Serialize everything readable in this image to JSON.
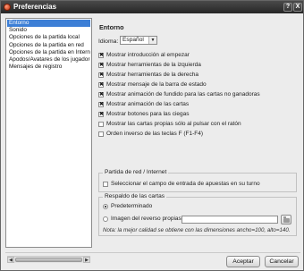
{
  "window": {
    "title": "Preferencias",
    "help_label": "?",
    "close_label": "X"
  },
  "sidebar": {
    "items": [
      {
        "label": "Entorno",
        "selected": true
      },
      {
        "label": "Sonido",
        "selected": false
      },
      {
        "label": "Opciones de la partida local",
        "selected": false
      },
      {
        "label": "Opciones de la partida en red",
        "selected": false
      },
      {
        "label": "Opciones de la partida en Internet",
        "selected": false
      },
      {
        "label": "Apodos/Avatares de los jugadores",
        "selected": false
      },
      {
        "label": "Mensajes de registro",
        "selected": false
      }
    ],
    "scroll_left": "◀",
    "scroll_right": "▶"
  },
  "panel": {
    "title": "Entorno",
    "language_label": "Idioma:",
    "language_value": "Español",
    "language_caret": "▼",
    "options": [
      {
        "label": "Mostrar introducción al empezar",
        "checked": true,
        "mark": "✖"
      },
      {
        "label": "Mostrar herramientas de la izquierda",
        "checked": true,
        "mark": "✖"
      },
      {
        "label": "Mostrar herramientas de la derecha",
        "checked": true,
        "mark": "✖"
      },
      {
        "label": "Mostrar mensaje de la barra de estado",
        "checked": true,
        "mark": "✖"
      },
      {
        "label": "Mostrar animación de fundido para las cartas no ganadoras",
        "checked": true,
        "mark": "✖"
      },
      {
        "label": "Mostrar animación de las cartas",
        "checked": true,
        "mark": "✖"
      },
      {
        "label": "Mostrar botones para las ciegas",
        "checked": true,
        "mark": "✖"
      },
      {
        "label": "Mostrar las cartas propias sólo al pulsar con el ratón",
        "checked": false,
        "mark": ""
      },
      {
        "label": "Orden inverso de las teclas F (F1-F4)",
        "checked": false,
        "mark": ""
      }
    ],
    "network_group": {
      "title": "Partida de red / Internet",
      "option": "Seleccionar el campo de entrada de apuestas en su turno"
    },
    "cards_group": {
      "title": "Respaldo de las cartas",
      "radio_default": "Predeterminado",
      "radio_custom": "Imagen del reverso propias:",
      "note": "Nota: la mejor calidad se obtiene con las dimensiones ancho=100, alto=140."
    }
  },
  "buttons": {
    "accept": "Aceptar",
    "cancel": "Cancelar"
  }
}
